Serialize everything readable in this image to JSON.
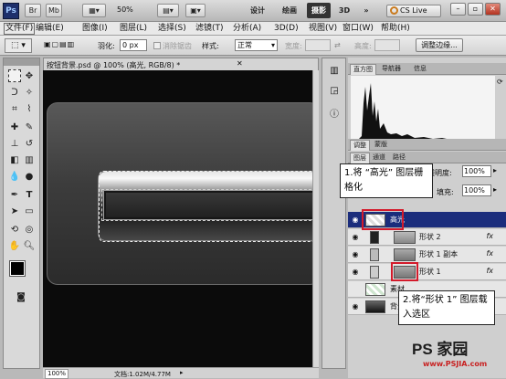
{
  "appbar": {
    "logo": "Ps",
    "zoom": "50%",
    "workspaces": [
      "设计",
      "绘画",
      "摄影",
      "3D"
    ],
    "active_workspace": "摄影",
    "more": "»",
    "cslive": "CS Live"
  },
  "menu": [
    "文件(F)",
    "编辑(E)",
    "图像(I)",
    "图层(L)",
    "选择(S)",
    "滤镜(T)",
    "分析(A)",
    "3D(D)",
    "视图(V)",
    "窗口(W)",
    "帮助(H)"
  ],
  "options": {
    "feather_label": "羽化:",
    "feather_value": "0 px",
    "antialias_label": "消除锯齿",
    "style_label": "样式:",
    "style_value": "正常",
    "width_label": "宽度:",
    "height_label": "高度:",
    "refine_button": "调整边缘..."
  },
  "document": {
    "tab_title": "按钮背景.psd @ 100% (高光, RGB/8) *",
    "zoom": "100%",
    "doc_info": "文档:1.02M/4.77M"
  },
  "panels": {
    "top_tabs": [
      "直方图",
      "导航器",
      "信息"
    ],
    "adjust_tabs": [
      "调整",
      "蒙版"
    ],
    "layer_tabs": [
      "图层",
      "通道",
      "路径"
    ],
    "opacity_label": "不透明度:",
    "opacity_value": "100%",
    "fill_label": "填充:",
    "fill_value": "100%"
  },
  "layers": [
    {
      "name": "高光",
      "fx": "",
      "selected": true
    },
    {
      "name": "形状 2",
      "fx": "fx",
      "selected": false
    },
    {
      "name": "形状 1 副本",
      "fx": "fx",
      "selected": false
    },
    {
      "name": "形状 1",
      "fx": "fx",
      "selected": false
    },
    {
      "name": "素材",
      "fx": "",
      "selected": false
    },
    {
      "name": "背景",
      "fx": "",
      "selected": false
    }
  ],
  "callouts": {
    "step1": "1.将 “高光” 图层栅格化",
    "step2": "2.将“形状 1” 图层载入选区"
  },
  "watermark": {
    "brand": "PS 家园",
    "url": "www.PSJIA.com"
  }
}
